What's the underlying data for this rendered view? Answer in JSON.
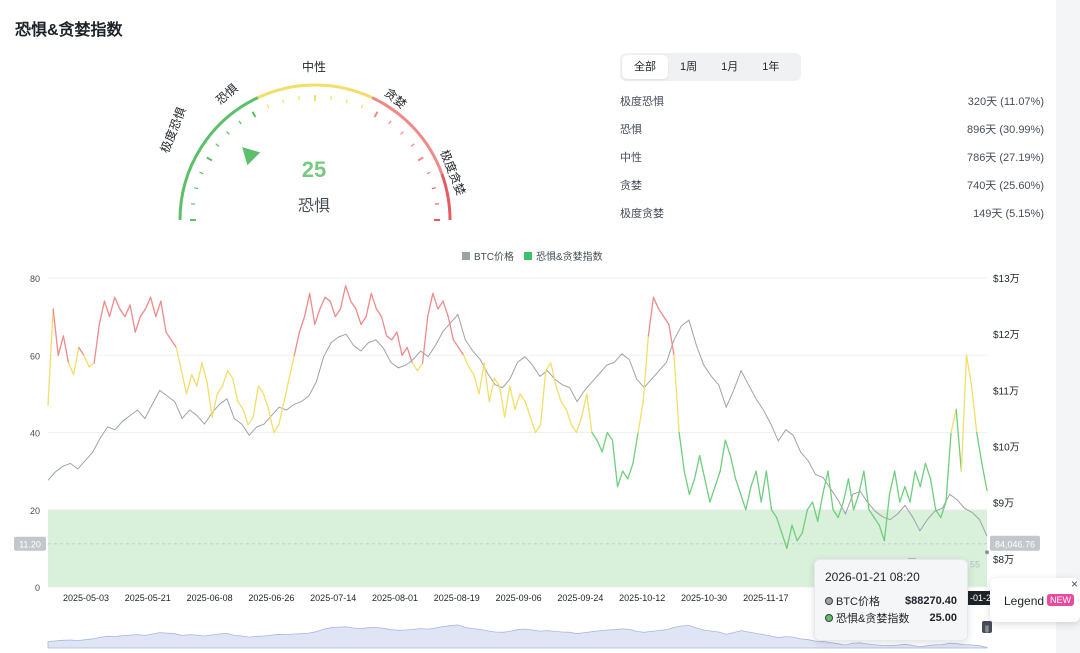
{
  "page_title": "恐惧&贪婪指数",
  "gauge": {
    "labels": {
      "extreme_fear": "极度恐惧",
      "fear": "恐惧",
      "neutral": "中性",
      "greed": "贪婪",
      "extreme_greed": "极度贪婪"
    },
    "value": "25",
    "status": "恐惧",
    "colors": {
      "fear": "#5cbf6a",
      "neutral": "#f3de68",
      "greed": "#ef8a8a",
      "extreme_greed": "#e35b63"
    }
  },
  "range_tabs": [
    {
      "label": "全部",
      "active": true
    },
    {
      "label": "1周",
      "active": false
    },
    {
      "label": "1月",
      "active": false
    },
    {
      "label": "1年",
      "active": false
    }
  ],
  "stats": [
    {
      "label": "极度恐惧",
      "value": "320天 (11.07%)"
    },
    {
      "label": "恐惧",
      "value": "896天 (30.99%)"
    },
    {
      "label": "中性",
      "value": "786天 (27.19%)"
    },
    {
      "label": "贪婪",
      "value": "740天 (25.60%)"
    },
    {
      "label": "极度贪婪",
      "value": "149天 (5.15%)"
    }
  ],
  "chart_legend": {
    "btc": {
      "label": "BTC价格",
      "color": "#9ea3a8"
    },
    "index": {
      "label": "恐惧&贪婪指数",
      "color": "#3cc26a"
    }
  },
  "chart_data": {
    "type": "line",
    "left_axis_ticks": [
      "0",
      "20",
      "40",
      "60",
      "80"
    ],
    "right_axis_ticks": [
      "$8万",
      "$9万",
      "$10万",
      "$11万",
      "$12万",
      "$13万"
    ],
    "left_ylim": [
      0,
      80
    ],
    "right_ylim": [
      75000,
      130000
    ],
    "x_ticks": [
      "2025-05-03",
      "2025-05-21",
      "2025-06-08",
      "2025-06-26",
      "2025-07-14",
      "2025-08-01",
      "2025-08-19",
      "2025-09-06",
      "2025-09-24",
      "2025-10-12",
      "2025-10-30",
      "2025-11-17",
      "20"
    ],
    "left_marker_label": "11.20",
    "right_marker_label": "84,046.76",
    "last_x_tick_fragment": "-01-2",
    "hidden_label_fragment": "55",
    "series": [
      {
        "name": "恐惧&贪婪指数",
        "values": [
          47,
          72,
          60,
          65,
          58,
          55,
          62,
          60,
          57,
          58,
          68,
          74,
          70,
          75,
          72,
          70,
          73,
          66,
          70,
          72,
          75,
          70,
          74,
          66,
          64,
          62,
          56,
          50,
          55,
          52,
          58,
          53,
          44,
          50,
          52,
          56,
          54,
          48,
          46,
          42,
          44,
          52,
          50,
          46,
          40,
          42,
          48,
          54,
          60,
          66,
          70,
          76,
          68,
          72,
          75,
          74,
          70,
          72,
          78,
          74,
          72,
          68,
          70,
          76,
          72,
          70,
          65,
          64,
          66,
          60,
          62,
          58,
          56,
          58,
          70,
          76,
          72,
          74,
          70,
          64,
          62,
          60,
          57,
          55,
          50,
          58,
          48,
          54,
          52,
          44,
          52,
          46,
          50,
          48,
          44,
          40,
          42,
          56,
          58,
          52,
          48,
          46,
          42,
          40,
          44,
          50,
          40,
          38,
          35,
          40,
          38,
          26,
          30,
          28,
          32,
          40,
          48,
          65,
          75,
          72,
          70,
          68,
          60,
          40,
          30,
          24,
          28,
          34,
          28,
          22,
          26,
          30,
          38,
          34,
          28,
          24,
          20,
          26,
          30,
          22,
          30,
          20,
          18,
          14,
          10,
          16,
          12,
          14,
          20,
          22,
          17,
          24,
          30,
          20,
          18,
          22,
          28,
          20,
          24,
          30,
          20,
          18,
          16,
          12,
          24,
          30,
          22,
          26,
          22,
          30,
          26,
          32,
          28,
          20,
          18,
          22,
          40,
          46,
          30,
          60,
          52,
          40,
          32,
          25
        ],
        "color_zones": "red>=60, yellow 40-60, green<40"
      },
      {
        "name": "BTC价格",
        "values": [
          94000,
          95500,
          96500,
          97000,
          96000,
          97500,
          99000,
          101500,
          103500,
          103000,
          104500,
          105500,
          106500,
          105000,
          107500,
          110000,
          109000,
          108000,
          105000,
          106500,
          105500,
          104000,
          106000,
          107500,
          108500,
          105000,
          104000,
          102000,
          103500,
          104000,
          105500,
          107000,
          106500,
          107500,
          108000,
          109000,
          111500,
          116000,
          118500,
          119500,
          120000,
          118000,
          117000,
          118500,
          119000,
          117500,
          115000,
          114000,
          114500,
          115500,
          117000,
          116000,
          118000,
          120500,
          122000,
          123500,
          119000,
          117000,
          115500,
          113000,
          111000,
          110500,
          112000,
          115000,
          116000,
          114500,
          112500,
          113500,
          112000,
          111000,
          110500,
          108000,
          110000,
          111500,
          113000,
          114500,
          115000,
          116500,
          115500,
          112000,
          110500,
          112000,
          113500,
          115000,
          119000,
          121500,
          122500,
          118000,
          114500,
          112500,
          111000,
          107000,
          110000,
          113500,
          111000,
          108500,
          106500,
          104000,
          101000,
          103000,
          102000,
          99000,
          97500,
          95000,
          94500,
          92500,
          90500,
          88000,
          91500,
          92000,
          90000,
          88500,
          87500,
          87000,
          88000,
          89500,
          87500,
          85000,
          87000,
          88500,
          89000,
          91500,
          90500,
          89000,
          88270,
          87000,
          84046
        ],
        "color": "#9ea3a8"
      }
    ],
    "fear_zone": [
      0,
      20
    ],
    "tooltip": {
      "date": "2026-01-21 08:20",
      "rows": [
        {
          "label": "BTC价格",
          "value": "$88270.40"
        },
        {
          "label": "恐惧&贪婪指数",
          "value": "25.00"
        }
      ]
    }
  },
  "legend_popup": {
    "label": "Legend",
    "badge": "NEW",
    "close": "×"
  },
  "zoom_handle": "||"
}
